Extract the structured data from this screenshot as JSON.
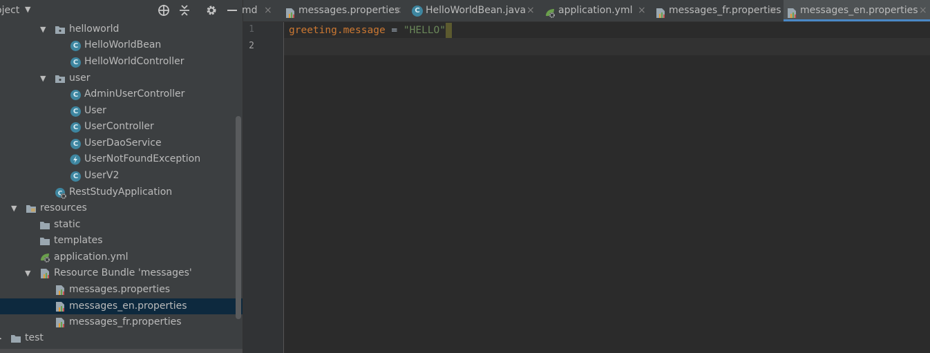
{
  "project_panel": {
    "title": "oject",
    "header_icons": [
      "crosshair-icon",
      "collapse-all-icon",
      "gear-icon",
      "minimize-icon"
    ],
    "tree": [
      {
        "label": "helloworld",
        "type": "package",
        "expanded": true
      },
      {
        "label": "HelloWorldBean",
        "type": "class"
      },
      {
        "label": "HelloWorldController",
        "type": "class"
      },
      {
        "label": "user",
        "type": "package",
        "expanded": true
      },
      {
        "label": "AdminUserController",
        "type": "class"
      },
      {
        "label": "User",
        "type": "class"
      },
      {
        "label": "UserController",
        "type": "class"
      },
      {
        "label": "UserDaoService",
        "type": "class"
      },
      {
        "label": "UserNotFoundException",
        "type": "exception"
      },
      {
        "label": "UserV2",
        "type": "class"
      },
      {
        "label": "RestStudyApplication",
        "type": "spring-app"
      },
      {
        "label": "resources",
        "type": "resources-folder",
        "expanded": true
      },
      {
        "label": "static",
        "type": "folder"
      },
      {
        "label": "templates",
        "type": "folder"
      },
      {
        "label": "application.yml",
        "type": "yml"
      },
      {
        "label": "Resource Bundle 'messages'",
        "type": "bundle",
        "expanded": true
      },
      {
        "label": "messages.properties",
        "type": "properties"
      },
      {
        "label": "messages_en.properties",
        "type": "properties",
        "selected": true
      },
      {
        "label": "messages_fr.properties",
        "type": "properties"
      },
      {
        "label": "test",
        "type": "folder",
        "expanded": false
      }
    ]
  },
  "editor": {
    "tabs": [
      {
        "label": "md",
        "type": "none",
        "active": false
      },
      {
        "label": "messages.properties",
        "type": "properties",
        "active": false
      },
      {
        "label": "HelloWorldBean.java",
        "type": "class",
        "active": false
      },
      {
        "label": "application.yml",
        "type": "yml",
        "active": false
      },
      {
        "label": "messages_fr.properties",
        "type": "properties",
        "active": false
      },
      {
        "label": "messages_en.properties",
        "type": "properties",
        "active": true
      }
    ],
    "close_glyph": "×",
    "line_numbers": [
      "1",
      "2"
    ],
    "code": {
      "key": "greeting.message",
      "operator": " = ",
      "value": "\"HELLO\""
    }
  },
  "colors": {
    "panel_bg": "#3c3f41",
    "editor_bg": "#2b2b2b",
    "selection": "#0d293e",
    "active_tab_underline": "#4a88c7",
    "property_key": "#cc7832",
    "property_value": "#6a8759"
  }
}
